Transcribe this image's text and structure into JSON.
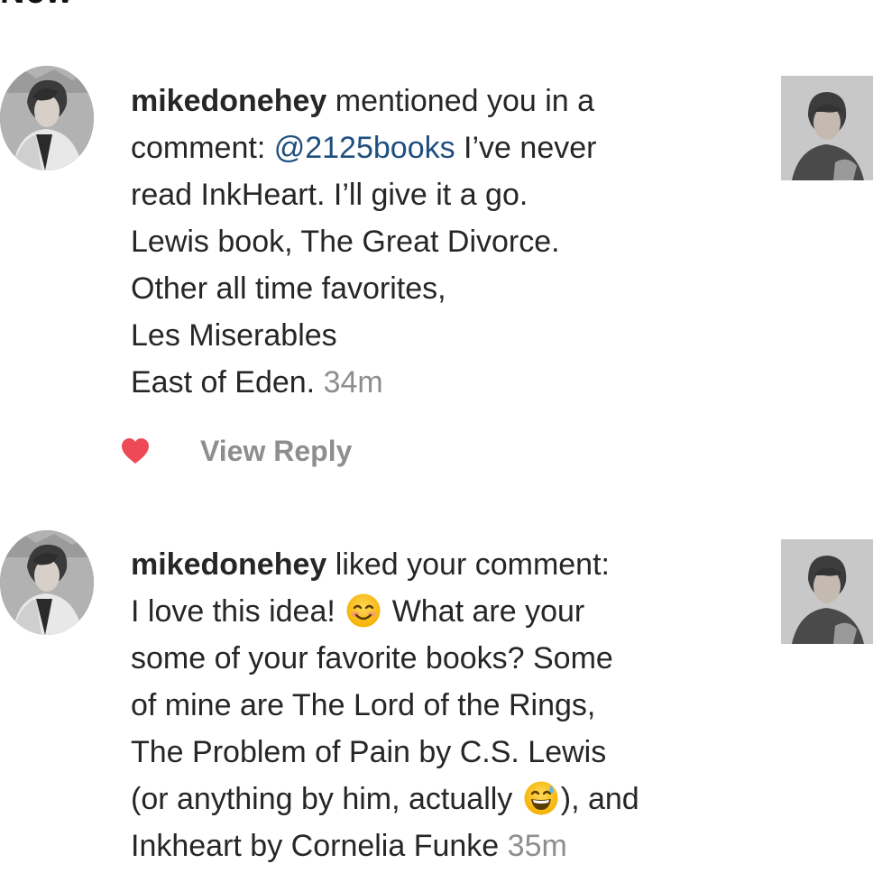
{
  "header": {
    "section_title": "New"
  },
  "notifications": [
    {
      "username": "mikedonehey",
      "action_text": " mentioned you in a",
      "line2_prefix": "comment: ",
      "mention": "@2125books",
      "line2_suffix": " I’ve never",
      "lines": [
        "read InkHeart. I’ll give it a go.",
        "Lewis book, The Great Divorce.",
        "Other all time favorites,",
        "Les Miserables"
      ],
      "last_line": "East of Eden. ",
      "time": "34m",
      "liked": true,
      "view_reply_label": "View Reply",
      "avatar_icon": "profile-photo",
      "thumbnail_icon": "post-thumbnail"
    },
    {
      "username": "mikedonehey",
      "action_text": " liked your comment:",
      "line2_before_emoji": "I love this idea! ",
      "line2_after_emoji": " What are your",
      "emoji_1": "smiling-face-with-smiling-eyes",
      "lines": [
        "some of your favorite books? Some",
        "of mine are The Lord of the Rings,",
        "The Problem of Pain by C.S. Lewis"
      ],
      "line6_before_emoji": "(or anything by him, actually ",
      "emoji_2": "grinning-face-with-sweat",
      "line6_after_emoji": "), and",
      "last_line": "Inkheart by Cornelia Funke ",
      "time": "35m",
      "avatar_icon": "profile-photo",
      "thumbnail_icon": "post-thumbnail"
    }
  ],
  "colors": {
    "text": "#262626",
    "mention": "#1f4f7f",
    "muted": "#8e8e8e",
    "like": "#ed4956"
  }
}
